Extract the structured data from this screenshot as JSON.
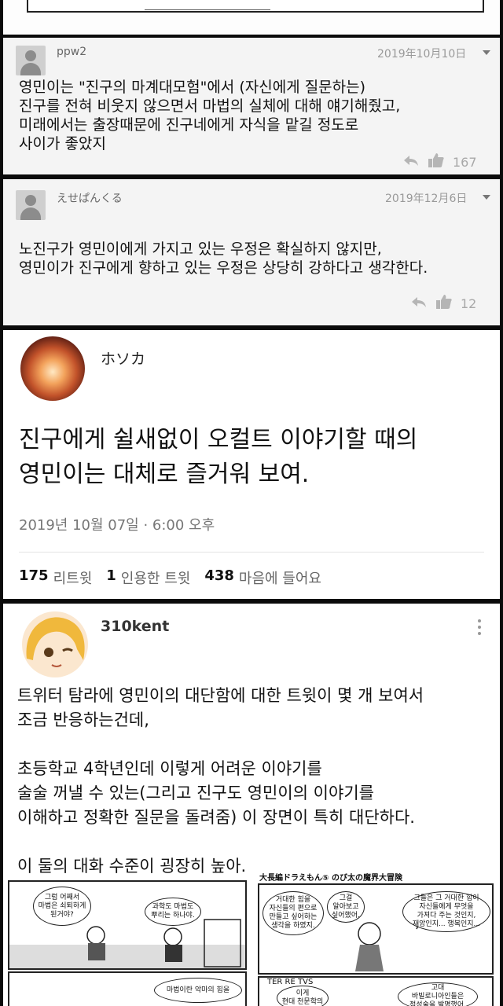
{
  "comments": [
    {
      "user": "ppw2",
      "date": "2019年10月10日",
      "text": "영민이는 \"진구의 마계대모험\"에서 (자신에게 질문하는)\n진구를 전혀 비웃지 않으면서 마법의 실체에 대해 얘기해줬고,\n미래에서는 출장때문에 진구네에게 자식을 맡길 정도로\n사이가 좋았지",
      "likes": "167"
    },
    {
      "user": "えせぱんくる",
      "date": "2019年12月6日",
      "text": "노진구가 영민이에게 가지고 있는 우정은 확실하지 않지만,\n영민이가 진구에게 향하고 있는 우정은 상당히 강하다고 생각한다.",
      "likes": "12"
    }
  ],
  "tweet": {
    "name": "ホソカ",
    "text": "진구에게 쉴새없이 오컬트 이야기할 때의\n영민이는 대체로 즐거워 보여.",
    "date": "2019년 10월 07일 · 6:00 오후",
    "retweets": "175",
    "retweets_label": "리트윗",
    "quotes": "1",
    "quotes_label": "인용한 트윗",
    "likes": "438",
    "likes_label": "마음에 들어요"
  },
  "post": {
    "user": "310kent",
    "text": "트위터 탐라에 영민이의 대단함에 대한 트윗이 몇 개 보여서\n조금 반응하는건데,\n\n초등학교 4학년인데 이렇게 어려운 이야기를\n술술 꺼낼 수 있는(그리고 진구도 영민이의 이야기를\n이해하고 정확한 질문을 돌려줌) 이 장면이 특히 대단하다.\n\n이 둘의 대화 수준이 굉장히 높아."
  },
  "manga": {
    "title": "大長編ドラえもん⑤ のび太の魔界大冒険",
    "bubbles": [
      "그럼 어째서\n마법은 쇠퇴하게\n된거야?",
      "과학도 마법도\n뿌리는 하나야.",
      "거대한 힘을\n자신들의 편으로\n만들고 싶어하는\n생각을 하였지.",
      "그걸\n알아보고\n싶어했어.",
      "그들은 그 거대한 힘이\n자신들에게 무엇을\n가져다 주는 것인지,\n재앙인지... 행복인지...",
      "마법이란 악마의 힘을",
      "이게\n현대 천문학의",
      "고대\n바빌로니아인들은\n점성술을 발명했어."
    ],
    "sign": "TER RE TVS"
  },
  "colors": {
    "like_icon": "#a8a8a8",
    "card_bg": "#f4f4f4"
  }
}
